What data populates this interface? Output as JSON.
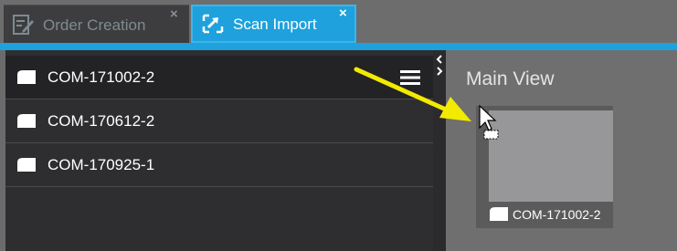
{
  "tabs": [
    {
      "label": "Order Creation",
      "icon": "order-creation-icon",
      "close": "×",
      "active": false
    },
    {
      "label": "Scan Import",
      "icon": "scan-import-icon",
      "close": "×",
      "active": true
    }
  ],
  "colors": {
    "accent": "#1ea1dc",
    "panel": "#2e2e30",
    "selected_row": "#232325",
    "main_bg": "#6f6f6f",
    "annotation_arrow": "#f2ea00"
  },
  "orders": {
    "items": [
      {
        "label": "COM-171002-2",
        "selected": true
      },
      {
        "label": "COM-170612-2",
        "selected": false
      },
      {
        "label": "COM-170925-1",
        "selected": false
      }
    ],
    "menu_icon": "hamburger-menu-icon"
  },
  "main_view": {
    "title": "Main View",
    "card": {
      "label": "COM-171002-2",
      "icon": "scan-icon"
    }
  },
  "cursor": {
    "icon": "drag-copy-cursor-icon"
  }
}
